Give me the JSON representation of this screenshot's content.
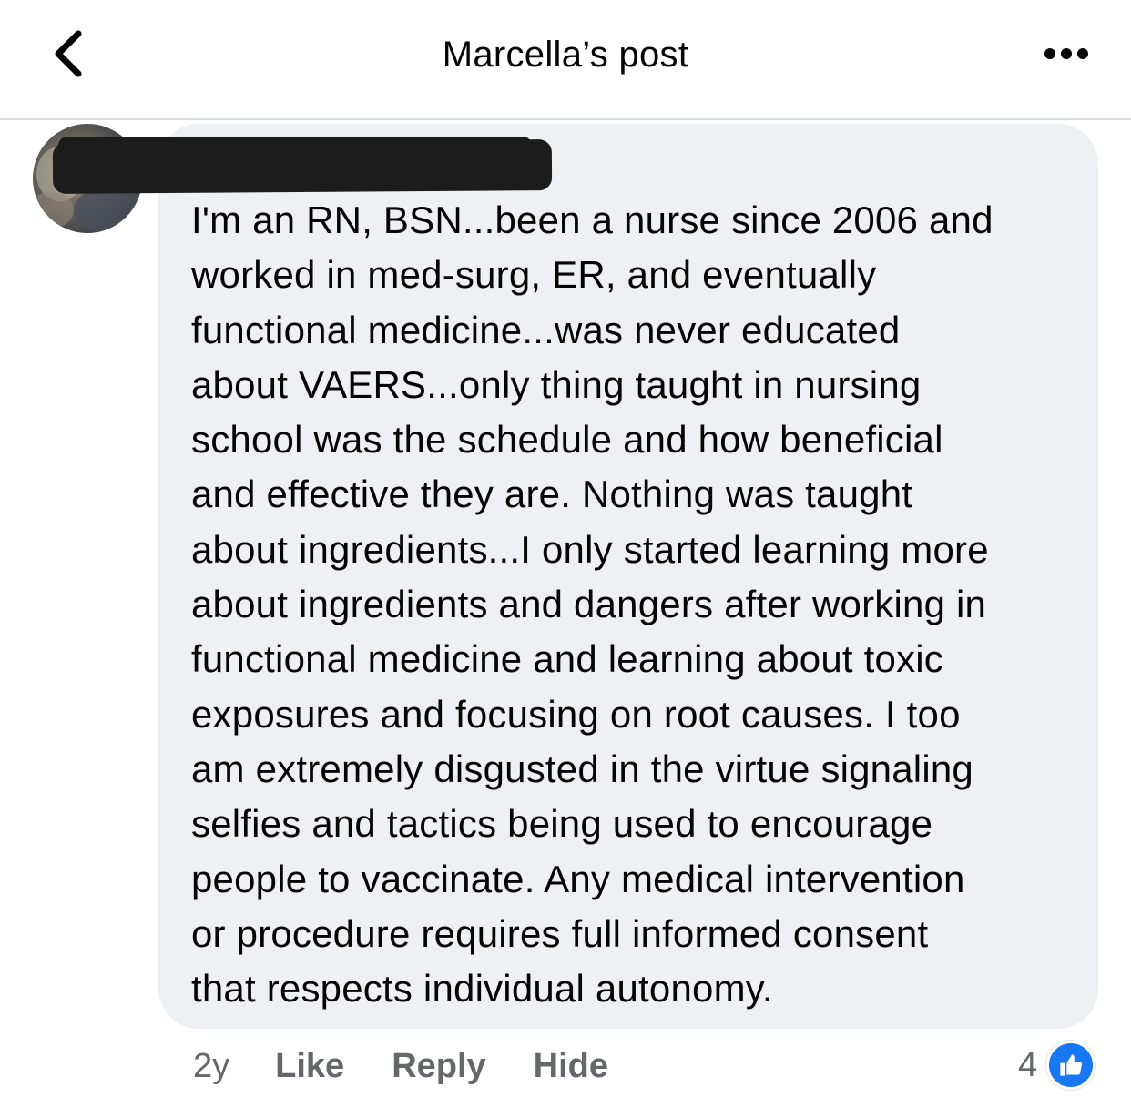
{
  "header": {
    "title": "Marcella’s post",
    "back_icon": "chevron-left-icon",
    "more_icon": "more-horizontal-icon"
  },
  "comment": {
    "text": "I'm an RN, BSN...been a nurse since 2006 and\nworked in med-surg, ER, and eventually\nfunctional medicine...was never educated\nabout VAERS...only thing taught in nursing\nschool was the schedule and how beneficial\nand effective they are. Nothing was taught\nabout ingredients...I only started learning more\nabout ingredients and dangers after working in\nfunctional medicine and learning about toxic\nexposures and focusing on root causes. I too\nam extremely disgusted in the virtue signaling\nselfies and tactics being used to encourage\npeople to vaccinate. Any medical intervention\nor procedure requires full informed consent\nthat respects individual autonomy.",
    "bubble_color": "#eff0f3"
  },
  "actions": {
    "time": "2y",
    "like": "Like",
    "reply": "Reply",
    "hide": "Hide"
  },
  "reactions": {
    "count": "4",
    "icon": "thumbs-up-icon",
    "color": "#1877f2"
  }
}
